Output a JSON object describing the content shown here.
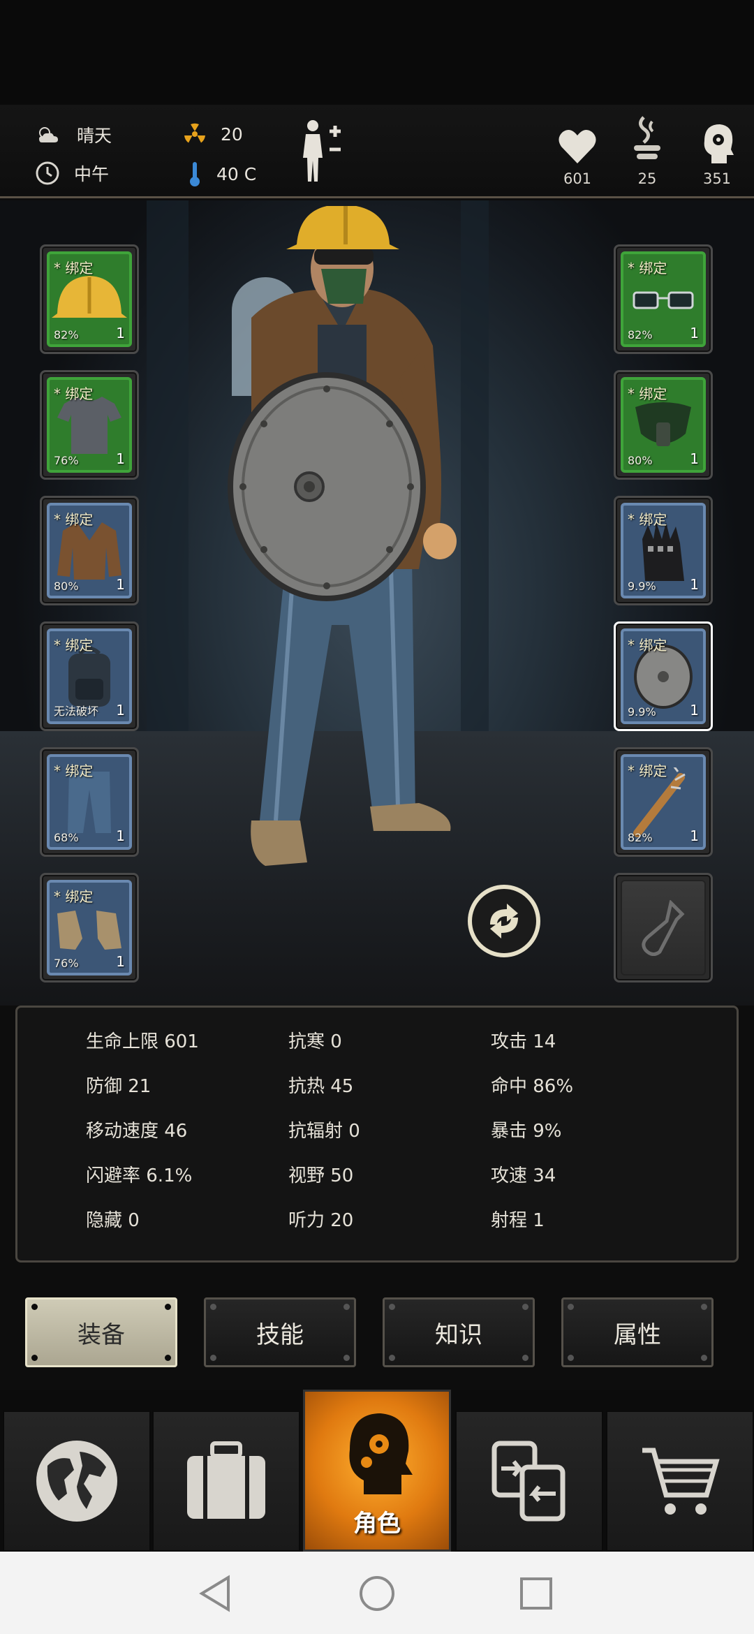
{
  "header": {
    "weather": "晴天",
    "time_of_day": "中午",
    "radiation": "20",
    "temperature": "40 C",
    "health": "601",
    "hunger": "25",
    "sanity": "351"
  },
  "equipment": {
    "left": [
      {
        "name": "helmet",
        "bind": "* 绑定",
        "durability": "82%",
        "count": "1",
        "rarity": "green"
      },
      {
        "name": "shirt",
        "bind": "* 绑定",
        "durability": "76%",
        "count": "1",
        "rarity": "green"
      },
      {
        "name": "jacket",
        "bind": "* 绑定",
        "durability": "80%",
        "count": "1",
        "rarity": "blue"
      },
      {
        "name": "backpack",
        "bind": "* 绑定",
        "durability": "无法破坏",
        "count": "1",
        "rarity": "blue"
      },
      {
        "name": "jeans",
        "bind": "* 绑定",
        "durability": "68%",
        "count": "1",
        "rarity": "blue"
      },
      {
        "name": "sneakers",
        "bind": "* 绑定",
        "durability": "76%",
        "count": "1",
        "rarity": "blue"
      }
    ],
    "right": [
      {
        "name": "glasses",
        "bind": "* 绑定",
        "durability": "82%",
        "count": "1",
        "rarity": "green"
      },
      {
        "name": "mask",
        "bind": "* 绑定",
        "durability": "80%",
        "count": "1",
        "rarity": "green"
      },
      {
        "name": "gloves",
        "bind": "* 绑定",
        "durability": "9.9%",
        "count": "1",
        "rarity": "blue"
      },
      {
        "name": "shield",
        "bind": "* 绑定",
        "durability": "9.9%",
        "count": "1",
        "rarity": "blue"
      },
      {
        "name": "spiked-bat",
        "bind": "* 绑定",
        "durability": "82%",
        "count": "1",
        "rarity": "blue"
      }
    ]
  },
  "stats": [
    [
      "生命上限 601",
      "抗寒 0",
      "攻击 14"
    ],
    [
      "防御 21",
      "抗热 45",
      "命中 86%"
    ],
    [
      "移动速度 46",
      "抗辐射 0",
      "暴击 9%"
    ],
    [
      "闪避率 6.1%",
      "视野 50",
      "攻速 34"
    ],
    [
      "隐藏 0",
      "听力 20",
      "射程 1"
    ]
  ],
  "tabs": [
    "装备",
    "技能",
    "知识",
    "属性"
  ],
  "nav": {
    "active_label": "角色"
  },
  "colors": {
    "accent": "#e88a14",
    "green_slot": "#2f7d2c",
    "blue_slot": "#3c5676"
  }
}
